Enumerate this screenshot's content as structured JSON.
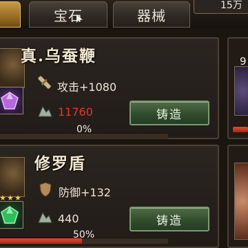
{
  "tabs": [
    {
      "label": "",
      "active": true
    },
    {
      "label": "宝石",
      "active": false
    },
    {
      "label": "器械",
      "active": false
    }
  ],
  "currency": {
    "amount": "15万"
  },
  "items": [
    {
      "name": "真.乌蚕鞭",
      "stat": "攻击+1080",
      "cost": "11760",
      "cost_sufficient": false,
      "button": "铸造",
      "progress": 0,
      "progress_label": "0%",
      "gem_color": "#b46ad8"
    },
    {
      "name": "修罗盾",
      "stat": "防御+132",
      "cost": "440",
      "cost_sufficient": true,
      "button": "铸造",
      "progress": 50,
      "progress_label": "50%",
      "gem_color": "#2fbf5a"
    }
  ],
  "side_items": [
    {
      "label": "9"
    },
    {
      "label": ""
    }
  ],
  "colors": {
    "accent_tab": "#b8862f",
    "cost_red": "#e03a2a",
    "button_green": "#3f5a38",
    "progress_red": "#d63a22"
  }
}
